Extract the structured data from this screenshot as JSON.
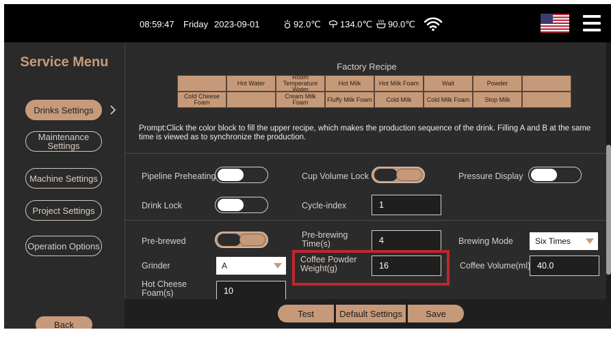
{
  "topbar": {
    "time": "08:59:47",
    "day": "Friday",
    "date": "2023-09-01",
    "temp1": "92.0℃",
    "temp2": "134.0℃",
    "temp3": "90.0℃",
    "icons": [
      "boiler-icon",
      "steam-icon",
      "cup-heat-icon",
      "wifi-icon",
      "us-flag-icon",
      "menu-icon"
    ]
  },
  "sidebar": {
    "title": "Service Menu",
    "items": [
      {
        "label": "Drinks Settings",
        "active": true
      },
      {
        "label": "Maintenance Settings",
        "active": false
      },
      {
        "label": "Machine Settings",
        "active": false
      },
      {
        "label": "Project Settings",
        "active": false
      },
      {
        "label": "Operation Options",
        "active": false
      }
    ],
    "back_label": "Back"
  },
  "recipe": {
    "title": "Factory Recipe",
    "row1": [
      "",
      "Hot Water",
      "Room Temperature Water",
      "Hot Milk",
      "Hot Milk Foam",
      "Wait",
      "Powder",
      ""
    ],
    "row2": [
      "Cold Cheese Foam",
      "",
      "Cream Milk Foam",
      "Fluffy Milk Foam",
      "Cold Milk",
      "Cold Milk Foam",
      "Stop Milk",
      ""
    ]
  },
  "prompt": "Prompt:Click the color block to fill the upper recipe, which makes the production sequence of the drink. Filling A and B at the same time is viewed as to synchronize the production.",
  "settings": {
    "pipeline_preheating": {
      "label": "Pipeline Preheating",
      "on": false
    },
    "cup_volume_lock": {
      "label": "Cup Volume Lock",
      "on": true
    },
    "pressure_display": {
      "label": "Pressure Display",
      "on": false
    },
    "drink_lock": {
      "label": "Drink Lock",
      "on": false
    },
    "cycle_index": {
      "label": "Cycle-index",
      "value": "1"
    },
    "pre_brewed": {
      "label": "Pre-brewed",
      "on": true
    },
    "pre_brewing_time": {
      "label": "Pre-brewing Time(s)",
      "value": "4"
    },
    "brewing_mode": {
      "label": "Brewing Mode",
      "value": "Six Times"
    },
    "grinder": {
      "label": "Grinder",
      "value": "A"
    },
    "coffee_powder_weight": {
      "label": "Coffee Powder Weight(g)",
      "value": "16"
    },
    "coffee_volume": {
      "label": "Coffee Volume(ml)",
      "value": "40.0"
    },
    "hot_cheese_foam": {
      "label": "Hot Cheese Foam(s)",
      "value": "10"
    }
  },
  "bottombar": {
    "test": "Test",
    "default_settings": "Default Settings",
    "save": "Save"
  },
  "colors": {
    "accent": "#c69a79",
    "highlight": "#c1262d",
    "background": "#2b2b2b"
  }
}
